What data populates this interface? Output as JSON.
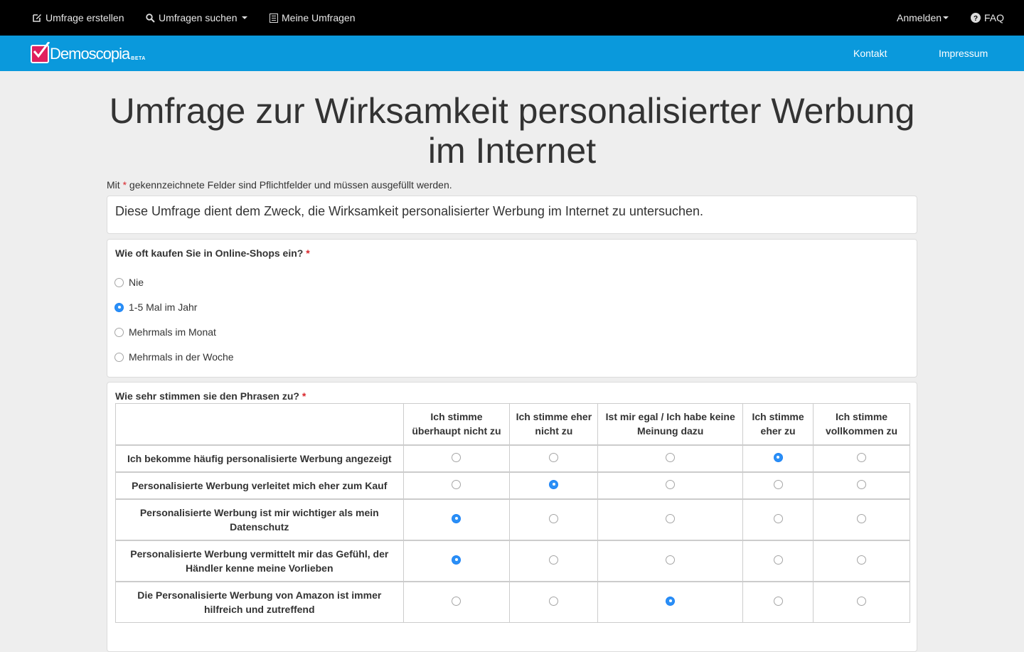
{
  "topnav": {
    "create": "Umfrage erstellen",
    "search": "Umfragen suchen",
    "mine": "Meine Umfragen",
    "login": "Anmelden",
    "faq": "FAQ"
  },
  "brand": {
    "name": "Demoscopia",
    "beta": "BETA",
    "kontakt": "Kontakt",
    "impressum": "Impressum",
    "bar_color": "#0a99dc",
    "logo_color": "#e0205e"
  },
  "survey": {
    "title": "Umfrage zur Wirksamkeit personalisierter Werbung im Internet",
    "required_note_pre": "Mit",
    "required_star": "*",
    "required_note_post": "gekennzeichnete Felder sind Pflichtfelder und müssen ausgefüllt werden.",
    "intro": "Diese Umfrage dient dem Zweck, die Wirksamkeit personalisierter Werbung im Internet zu untersuchen."
  },
  "q1": {
    "label": "Wie oft kaufen Sie in Online-Shops ein?",
    "star": "*",
    "options": [
      "Nie",
      "1-5 Mal im Jahr",
      "Mehrmals im Monat",
      "Mehrmals in der Woche"
    ],
    "selected_index": 1
  },
  "q2": {
    "label": "Wie sehr stimmen sie den Phrasen zu?",
    "star": "*",
    "columns": [
      "Ich stimme überhaupt nicht zu",
      "Ich stimme eher nicht zu",
      "Ist mir egal / Ich habe keine Meinung dazu",
      "Ich stimme eher zu",
      "Ich stimme vollkommen zu"
    ],
    "rows": [
      {
        "statement": "Ich bekomme häufig personalisierte Werbung angezeigt",
        "selected": 3
      },
      {
        "statement": "Personalisierte Werbung verleitet mich eher zum Kauf",
        "selected": 1
      },
      {
        "statement": "Personalisierte Werbung ist mir wichtiger als mein Datenschutz",
        "selected": 0
      },
      {
        "statement": "Personalisierte Werbung vermittelt mir das Gefühl, der Händler kenne meine Vorlieben",
        "selected": 0
      },
      {
        "statement": "Die Personalisierte Werbung von Amazon ist immer hilfreich und zutreffend",
        "selected": 2
      }
    ]
  },
  "accent_color": "#2b8ff5"
}
